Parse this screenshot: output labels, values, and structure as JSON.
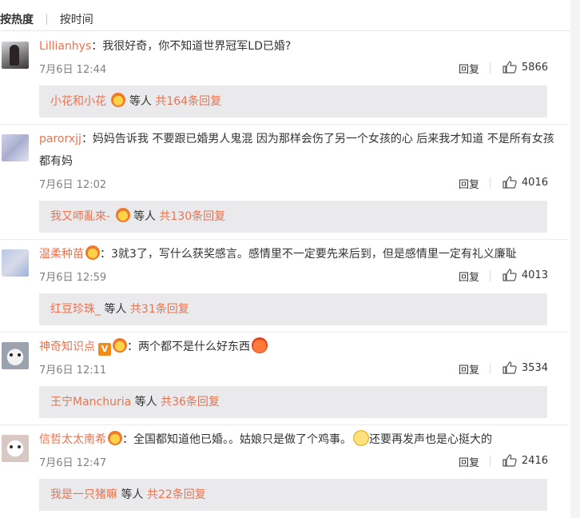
{
  "sort": {
    "hot": "按热度",
    "time": "按时间"
  },
  "labels": {
    "reply": "回复",
    "others": "等人"
  },
  "colors": {
    "link": "#eb7350",
    "sub_bg": "#eaeaec"
  },
  "comments": [
    {
      "user": "Lillianhys",
      "text": "：我很好奇，你不知道世界冠军LD已婚?",
      "time": "7月6日 12:44",
      "likes": "5866",
      "sub_name": "小花和小花",
      "sub_count": "共164条回复"
    },
    {
      "user": "parorxjj",
      "text": "：妈妈告诉我 不要跟已婚男人鬼混 因为那样会伤了另一个女孩的心 后来我才知道 不是所有女孩都有妈",
      "time": "7月6日 12:02",
      "likes": "4016",
      "sub_name": "我又𠯗亂來-",
      "sub_count": "共130条回复"
    },
    {
      "user": "温柔种苗",
      "text": "：3就3了，写什么获奖感言。感情里不一定要先来后到，但是感情里一定有礼义廉耻",
      "time": "7月6日 12:59",
      "likes": "4013",
      "sub_name": "红豆珍珠_",
      "sub_count": "共31条回复"
    },
    {
      "user": "神奇知识点",
      "text": "：两个都不是什么好东西",
      "time": "7月6日 12:11",
      "likes": "3534",
      "sub_name": "王宁Manchuria",
      "sub_count": "共36条回复"
    },
    {
      "user": "信哲太太南希",
      "text": "：全国都知道他已婚。。姑娘只是做了个鸡事。",
      "text2": "还要再发声也是心挺大的",
      "time": "7月6日 12:47",
      "likes": "2416",
      "sub_name": "我是一只猪嘛",
      "sub_count": "共22条回复"
    }
  ]
}
